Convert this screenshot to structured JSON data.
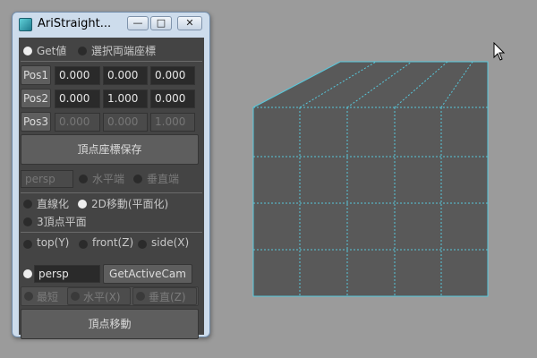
{
  "window": {
    "title": "AriStraight...",
    "minimize_glyph": "—",
    "maximize_glyph": "□",
    "close_glyph": "✕"
  },
  "mode": {
    "get_value_label": "Get値",
    "select_endpoints_label": "選択両端座標"
  },
  "positions": [
    {
      "label": "Pos1",
      "values": [
        "0.000",
        "0.000",
        "0.000"
      ]
    },
    {
      "label": "Pos2",
      "values": [
        "0.000",
        "1.000",
        "0.000"
      ]
    },
    {
      "label": "Pos3",
      "values": [
        "0.000",
        "0.000",
        "1.000"
      ]
    }
  ],
  "save_button_label": "頂点座標保存",
  "camera_field_value": "persp",
  "edge": {
    "horizontal_label": "水平端",
    "vertical_label": "垂直端"
  },
  "method": {
    "straighten_label": "直線化",
    "move2d_label": "2D移動(平面化)",
    "three_point_label": "3頂点平面"
  },
  "views": {
    "top_label": "top(Y)",
    "front_label": "front(Z)",
    "side_label": "side(X)",
    "persp_field_value": "persp",
    "get_active_cam_label": "GetActiveCam"
  },
  "move_option": {
    "shortest_label": "最短",
    "horizontal_label": "水平(X)",
    "vertical_label": "垂直(Z)"
  },
  "move_button_label": "頂点移動",
  "colors": {
    "background": "#9b9b9b",
    "panel": "#444444",
    "mesh_face": "#595959",
    "mesh_edge": "#56c8dc"
  },
  "icons": {
    "app": "app-icon",
    "cursor": "mouse-pointer-icon"
  }
}
